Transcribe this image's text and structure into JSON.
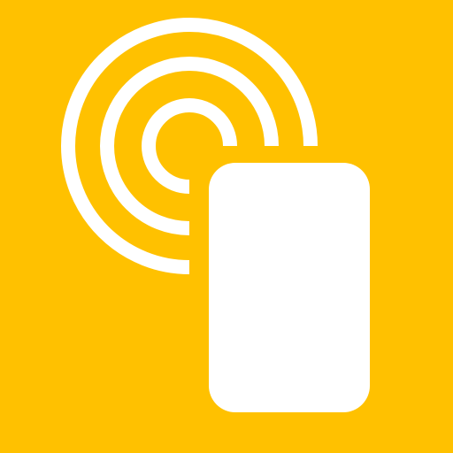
{
  "app_icon": {
    "name": "nfc-tap-icon",
    "colors": {
      "background": "#FFC100",
      "foreground": "#FFFFFF"
    }
  }
}
